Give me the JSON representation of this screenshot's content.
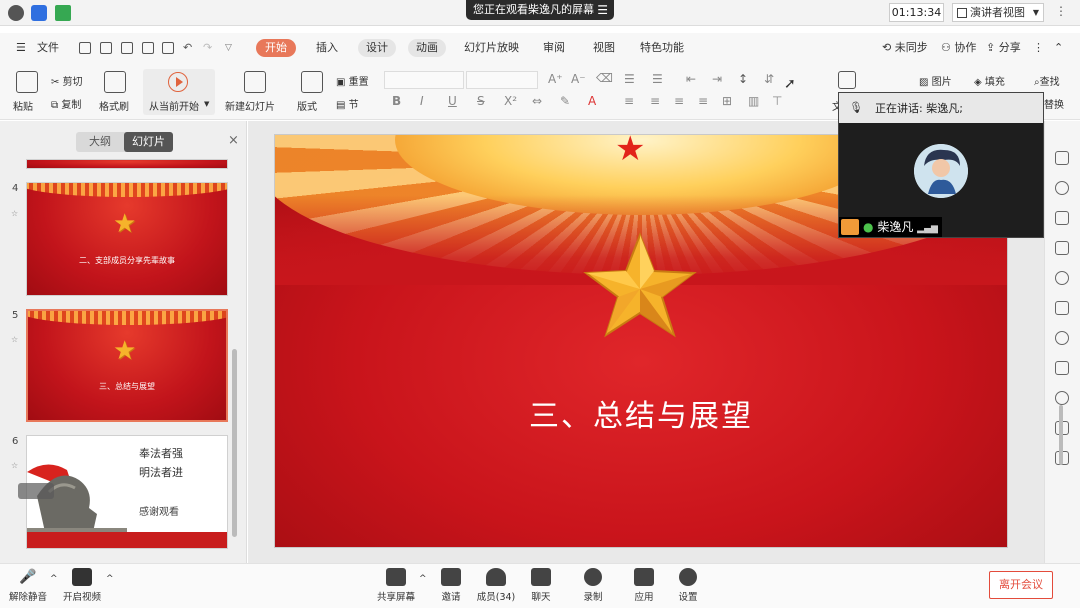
{
  "meeting": {
    "share_banner": "您正在观看柴逸凡的屏幕",
    "timer": "01:13:34",
    "presenter_view": "演讲者视图",
    "speaker_label": "正在讲话: 柴逸凡;",
    "speaker_name": "柴逸凡",
    "bottom": {
      "mute": "解除静音",
      "video": "开启视频",
      "share": "共享屏幕",
      "invite": "邀请",
      "members": "成员(34)",
      "chat": "聊天",
      "record": "录制",
      "apps": "应用",
      "settings": "设置",
      "leave": "离开会议"
    }
  },
  "editor": {
    "menu": {
      "file": "文件",
      "tabs": [
        "开始",
        "插入",
        "设计",
        "动画",
        "幻灯片放映",
        "审阅",
        "视图",
        "特色功能"
      ],
      "sync": "未同步",
      "collab": "协作",
      "share": "分享"
    },
    "ribbon": {
      "paste": "粘贴",
      "cut": "剪切",
      "copy": "复制",
      "format_painter": "格式刷",
      "from_current": "从当前开始",
      "new_slide": "新建幻灯片",
      "layout": "版式",
      "section": "节",
      "reset": "重置",
      "picture": "图片",
      "fill": "填充",
      "find_partial": "查找",
      "replace_partial": "替换",
      "text_partial": "文"
    },
    "panel": {
      "tab_outline": "大纲",
      "tab_slides": "幻灯片",
      "close": "×"
    },
    "slides": [
      {
        "num": "4",
        "caption": "二、支部成员分享先辈故事"
      },
      {
        "num": "5",
        "caption": "三、总结与展望"
      },
      {
        "num": "6",
        "lines": [
          "奉法者强",
          "明法者进",
          "感谢观看"
        ]
      }
    ],
    "current_slide_title": "三、总结与展望"
  },
  "colors": {
    "accent": "#e8785a",
    "slide_red": "#c9141b",
    "star_gold": "#f6b32b",
    "leave_red": "#e34b3b"
  }
}
